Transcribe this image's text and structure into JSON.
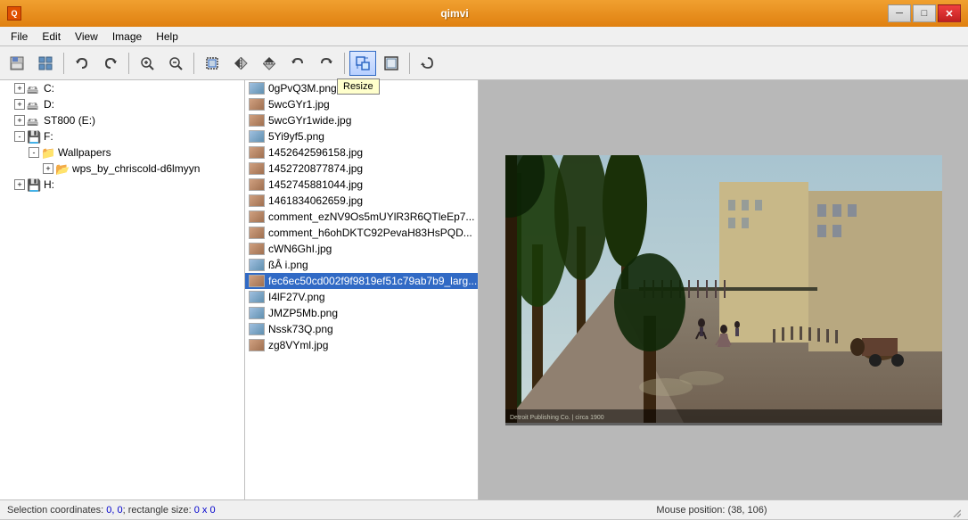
{
  "app": {
    "title": "qimvi",
    "title_icon": "Q"
  },
  "titlebar": {
    "minimize": "─",
    "restore": "□",
    "close": "✕"
  },
  "menubar": {
    "items": [
      "File",
      "Edit",
      "View",
      "Image",
      "Help"
    ]
  },
  "toolbar": {
    "tooltip": "Resize",
    "buttons": [
      {
        "name": "save",
        "icon": "💾"
      },
      {
        "name": "chart",
        "icon": "📊"
      },
      {
        "name": "undo",
        "icon": "↩"
      },
      {
        "name": "redo",
        "icon": "↪"
      },
      {
        "name": "zoom-in",
        "icon": "🔍"
      },
      {
        "name": "zoom-out",
        "icon": "🔎"
      },
      {
        "name": "crop",
        "icon": "⬛"
      },
      {
        "name": "flip-h",
        "icon": "↔"
      },
      {
        "name": "flip-v",
        "icon": "↕"
      },
      {
        "name": "rotate-ccw",
        "icon": "⟲"
      },
      {
        "name": "rotate-cw",
        "icon": "⟳"
      },
      {
        "name": "resize",
        "icon": "⤢"
      },
      {
        "name": "fit",
        "icon": "⤡"
      },
      {
        "name": "refresh",
        "icon": "↻"
      }
    ]
  },
  "tree": {
    "items": [
      {
        "id": "c",
        "label": "C:",
        "level": 1,
        "toggle": "+",
        "icon": "drive",
        "expanded": false
      },
      {
        "id": "d",
        "label": "D:",
        "level": 1,
        "toggle": "+",
        "icon": "drive",
        "expanded": false
      },
      {
        "id": "st800",
        "label": "ST800 (E:)",
        "level": 1,
        "toggle": "+",
        "icon": "drive",
        "expanded": false
      },
      {
        "id": "f",
        "label": "F:",
        "level": 1,
        "toggle": "-",
        "icon": "hdd",
        "expanded": true
      },
      {
        "id": "wallpapers",
        "label": "Wallpapers",
        "level": 2,
        "toggle": "-",
        "icon": "folder",
        "expanded": true
      },
      {
        "id": "wps",
        "label": "wps_by_chriscold-d6lmyyn",
        "level": 3,
        "toggle": "+",
        "icon": "folder",
        "expanded": false
      },
      {
        "id": "h",
        "label": "H:",
        "level": 1,
        "toggle": "+",
        "icon": "hdd",
        "expanded": false
      }
    ]
  },
  "files": [
    {
      "name": "0gPvQ3M.png",
      "type": "png",
      "selected": false
    },
    {
      "name": "5wcGYr1.jpg",
      "type": "jpg",
      "selected": false
    },
    {
      "name": "5wcGYr1wide.jpg",
      "type": "jpg",
      "selected": false
    },
    {
      "name": "5Yi9yf5.png",
      "type": "png",
      "selected": false
    },
    {
      "name": "1452642596158.jpg",
      "type": "jpg",
      "selected": false
    },
    {
      "name": "1452720877874.jpg",
      "type": "jpg",
      "selected": false
    },
    {
      "name": "1452745881044.jpg",
      "type": "jpg",
      "selected": false
    },
    {
      "name": "1461834062659.jpg",
      "type": "jpg",
      "selected": false
    },
    {
      "name": "comment_ezNV9Os5mUYlR3R6QTleEp7...",
      "type": "jpg",
      "selected": false
    },
    {
      "name": "comment_h6ohDKTC92PevaH83HsPQD...",
      "type": "jpg",
      "selected": false
    },
    {
      "name": "cWN6GhI.jpg",
      "type": "jpg",
      "selected": false
    },
    {
      "name": "ßÂ i.png",
      "type": "png",
      "selected": false
    },
    {
      "name": "fec6ec50cd002f9f9819ef51c79ab7b9_larg...",
      "type": "jpg",
      "selected": true
    },
    {
      "name": "I4lF27V.png",
      "type": "png",
      "selected": false
    },
    {
      "name": "JMZP5Mb.png",
      "type": "png",
      "selected": false
    },
    {
      "name": "Nssk73Q.png",
      "type": "png",
      "selected": false
    },
    {
      "name": "zg8VYml.jpg",
      "type": "jpg",
      "selected": false
    }
  ],
  "statusbar": {
    "selection_label": "Selection coordinates: ",
    "selection_coords": "0, 0",
    "selection_sep": "; rectangle size: ",
    "selection_size": "0 x 0",
    "mouse_label": "Mouse position: ",
    "mouse_pos": "(38, 106)"
  }
}
